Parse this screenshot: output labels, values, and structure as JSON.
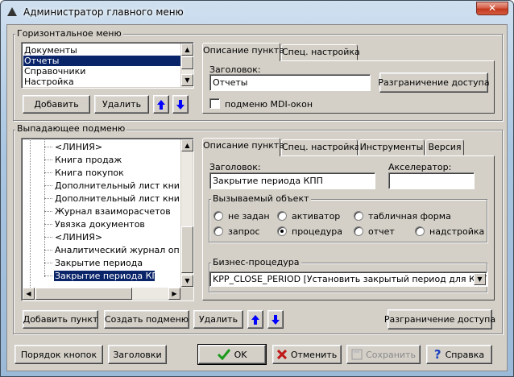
{
  "window": {
    "title": "Администратор главного меню",
    "close_glyph": "✕"
  },
  "top": {
    "group_title": "Горизонтальное меню",
    "list": [
      "Документы",
      "Отчеты",
      "Справочники",
      "Настройка"
    ],
    "selected_index": 1,
    "add_label": "Добавить",
    "delete_label": "Удалить",
    "tabs": [
      "Описание пункта",
      "Спец. настройка"
    ],
    "header_label": "Заголовок:",
    "header_value": "Отчеты",
    "access_label": "Разграничение доступа",
    "mdi_label": "подменю MDI-окон"
  },
  "sub": {
    "group_title": "Выпадающее подменю",
    "tree": [
      "<ЛИНИЯ>",
      "Книга продаж",
      "Книга покупок",
      "Дополнительный лист книги п",
      "Дополнительный лист книги п",
      "Журнал взаиморасчетов",
      "Увязка документов",
      "<ЛИНИЯ>",
      "Аналитический журнал операц",
      "Закрытие периода",
      "Закрытие периода КПП"
    ],
    "selected_index": 10,
    "tabs": [
      "Описание пункта",
      "Спец. настройка",
      "Инструменты",
      "Версия"
    ],
    "header_label": "Заголовок:",
    "header_value": "Закрытие периода КПП",
    "accel_label": "Акселератор:",
    "accel_value": "",
    "object_group": "Вызываемый объект",
    "radios": [
      "не задан",
      "активатор",
      "табличная форма",
      "запрос",
      "процедура",
      "отчет",
      "надстройка"
    ],
    "radio_selected": 4,
    "bp_group": "Бизнес-процедура",
    "bp_value": "KPP_CLOSE_PERIOD [Установить закрытый период для КПП]",
    "add_item_label": "Добавить пункт",
    "create_sub_label": "Создать подменю",
    "delete_label": "Удалить",
    "access_label": "Разграничение доступа"
  },
  "bottom": {
    "order_label": "Порядок кнопок",
    "headers_label": "Заголовки",
    "ok_label": "OK",
    "cancel_label": "Отменить",
    "save_label": "Сохранить",
    "help_label": "Справка"
  },
  "colors": {
    "selection": "#0a246a",
    "ok_check": "#1a9a1a",
    "cancel_x": "#c01818",
    "arrow_blue": "#0000ff",
    "help_q": "#1a3fc0"
  }
}
